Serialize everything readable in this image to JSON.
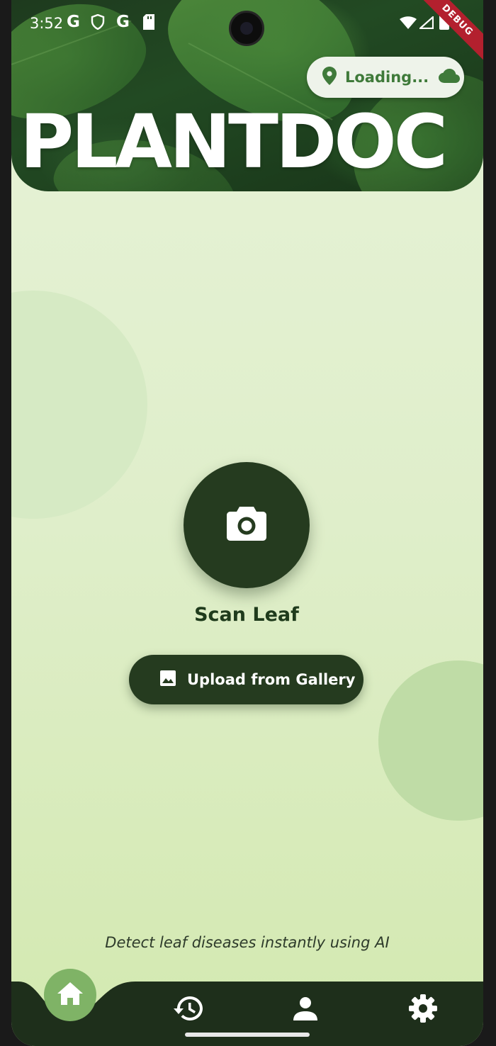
{
  "status_bar": {
    "time": "3:52",
    "left_icons": [
      "g-icon",
      "shield-icon",
      "g-icon",
      "sd-card-icon"
    ],
    "right_icons": [
      "wifi-icon",
      "signal-icon",
      "battery-icon"
    ]
  },
  "debug_banner": "DEBUG",
  "header": {
    "title": "PLANTDOC",
    "location": {
      "icon": "location-pin-icon",
      "text": "Loading...",
      "weather_icon": "cloud-icon"
    }
  },
  "main": {
    "scan_button": {
      "icon": "camera-icon",
      "label": "Scan Leaf"
    },
    "upload_button": {
      "icon": "image-icon",
      "label": "Upload from Gallery"
    },
    "tagline": "Detect leaf diseases instantly using AI"
  },
  "bottom_nav": {
    "items": [
      {
        "name": "home",
        "icon": "home-icon",
        "active": true
      },
      {
        "name": "history",
        "icon": "history-icon",
        "active": false
      },
      {
        "name": "profile",
        "icon": "person-icon",
        "active": false
      },
      {
        "name": "settings",
        "icon": "gear-icon",
        "active": false
      }
    ]
  },
  "colors": {
    "primary_dark": "#253b1f",
    "accent_green": "#7fb366",
    "background_light": "#e7f3d8",
    "location_text": "#3f7a3a",
    "debug_red": "#b3202e"
  }
}
